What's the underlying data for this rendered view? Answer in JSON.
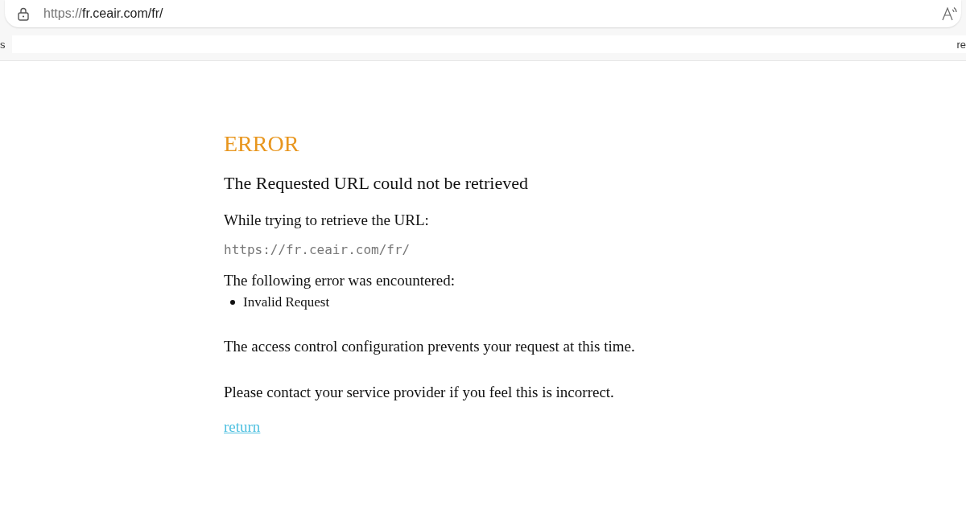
{
  "browser": {
    "url_scheme": "https://",
    "url_rest": "fr.ceair.com/fr/",
    "bookmarks": [
      "s",
      "re"
    ]
  },
  "page": {
    "title": "ERROR",
    "heading": "The Requested URL could not be retrieved",
    "intro": "While trying to retrieve the URL:",
    "url": "https://fr.ceair.com/fr/",
    "error_label": "The following error was encountered:",
    "errors": [
      "Invalid Request"
    ],
    "explanation": "The access control configuration prevents your request at this time.",
    "advice": "Please contact your service provider if you feel this is incorrect.",
    "link": "return"
  }
}
